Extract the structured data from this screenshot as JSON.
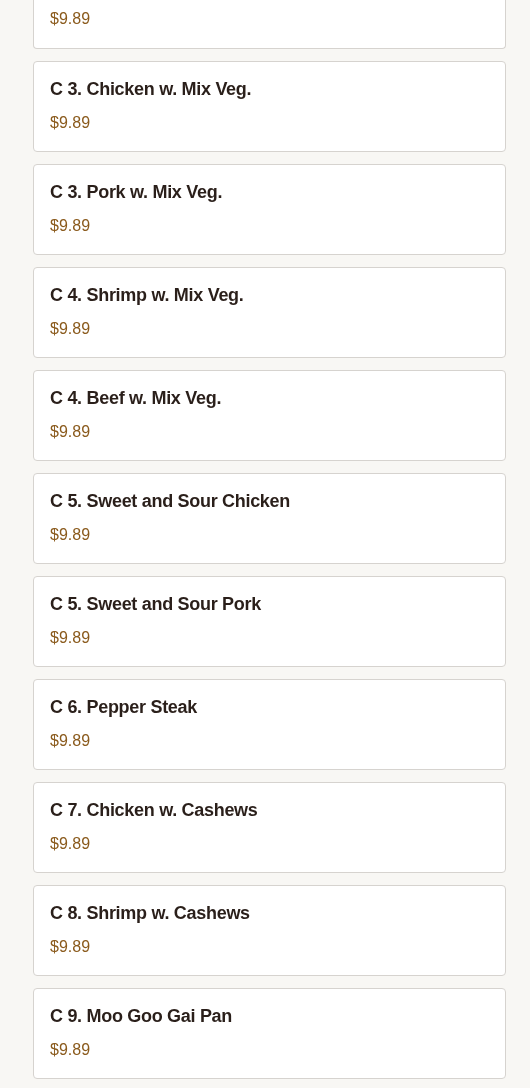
{
  "menu_items": [
    {
      "price": "$9.89"
    },
    {
      "name": "C 3. Chicken w. Mix Veg.",
      "price": "$9.89"
    },
    {
      "name": "C 3. Pork w. Mix Veg.",
      "price": "$9.89"
    },
    {
      "name": "C 4. Shrimp w. Mix Veg.",
      "price": "$9.89"
    },
    {
      "name": "C 4. Beef w. Mix Veg.",
      "price": "$9.89"
    },
    {
      "name": "C 5. Sweet and Sour Chicken",
      "price": "$9.89"
    },
    {
      "name": "C 5. Sweet and Sour Pork",
      "price": "$9.89"
    },
    {
      "name": "C 6. Pepper Steak",
      "price": "$9.89"
    },
    {
      "name": "C 7. Chicken w. Cashews",
      "price": "$9.89"
    },
    {
      "name": "C 8. Shrimp w. Cashews",
      "price": "$9.89"
    },
    {
      "name": "C 9. Moo Goo Gai Pan",
      "price": "$9.89"
    }
  ]
}
